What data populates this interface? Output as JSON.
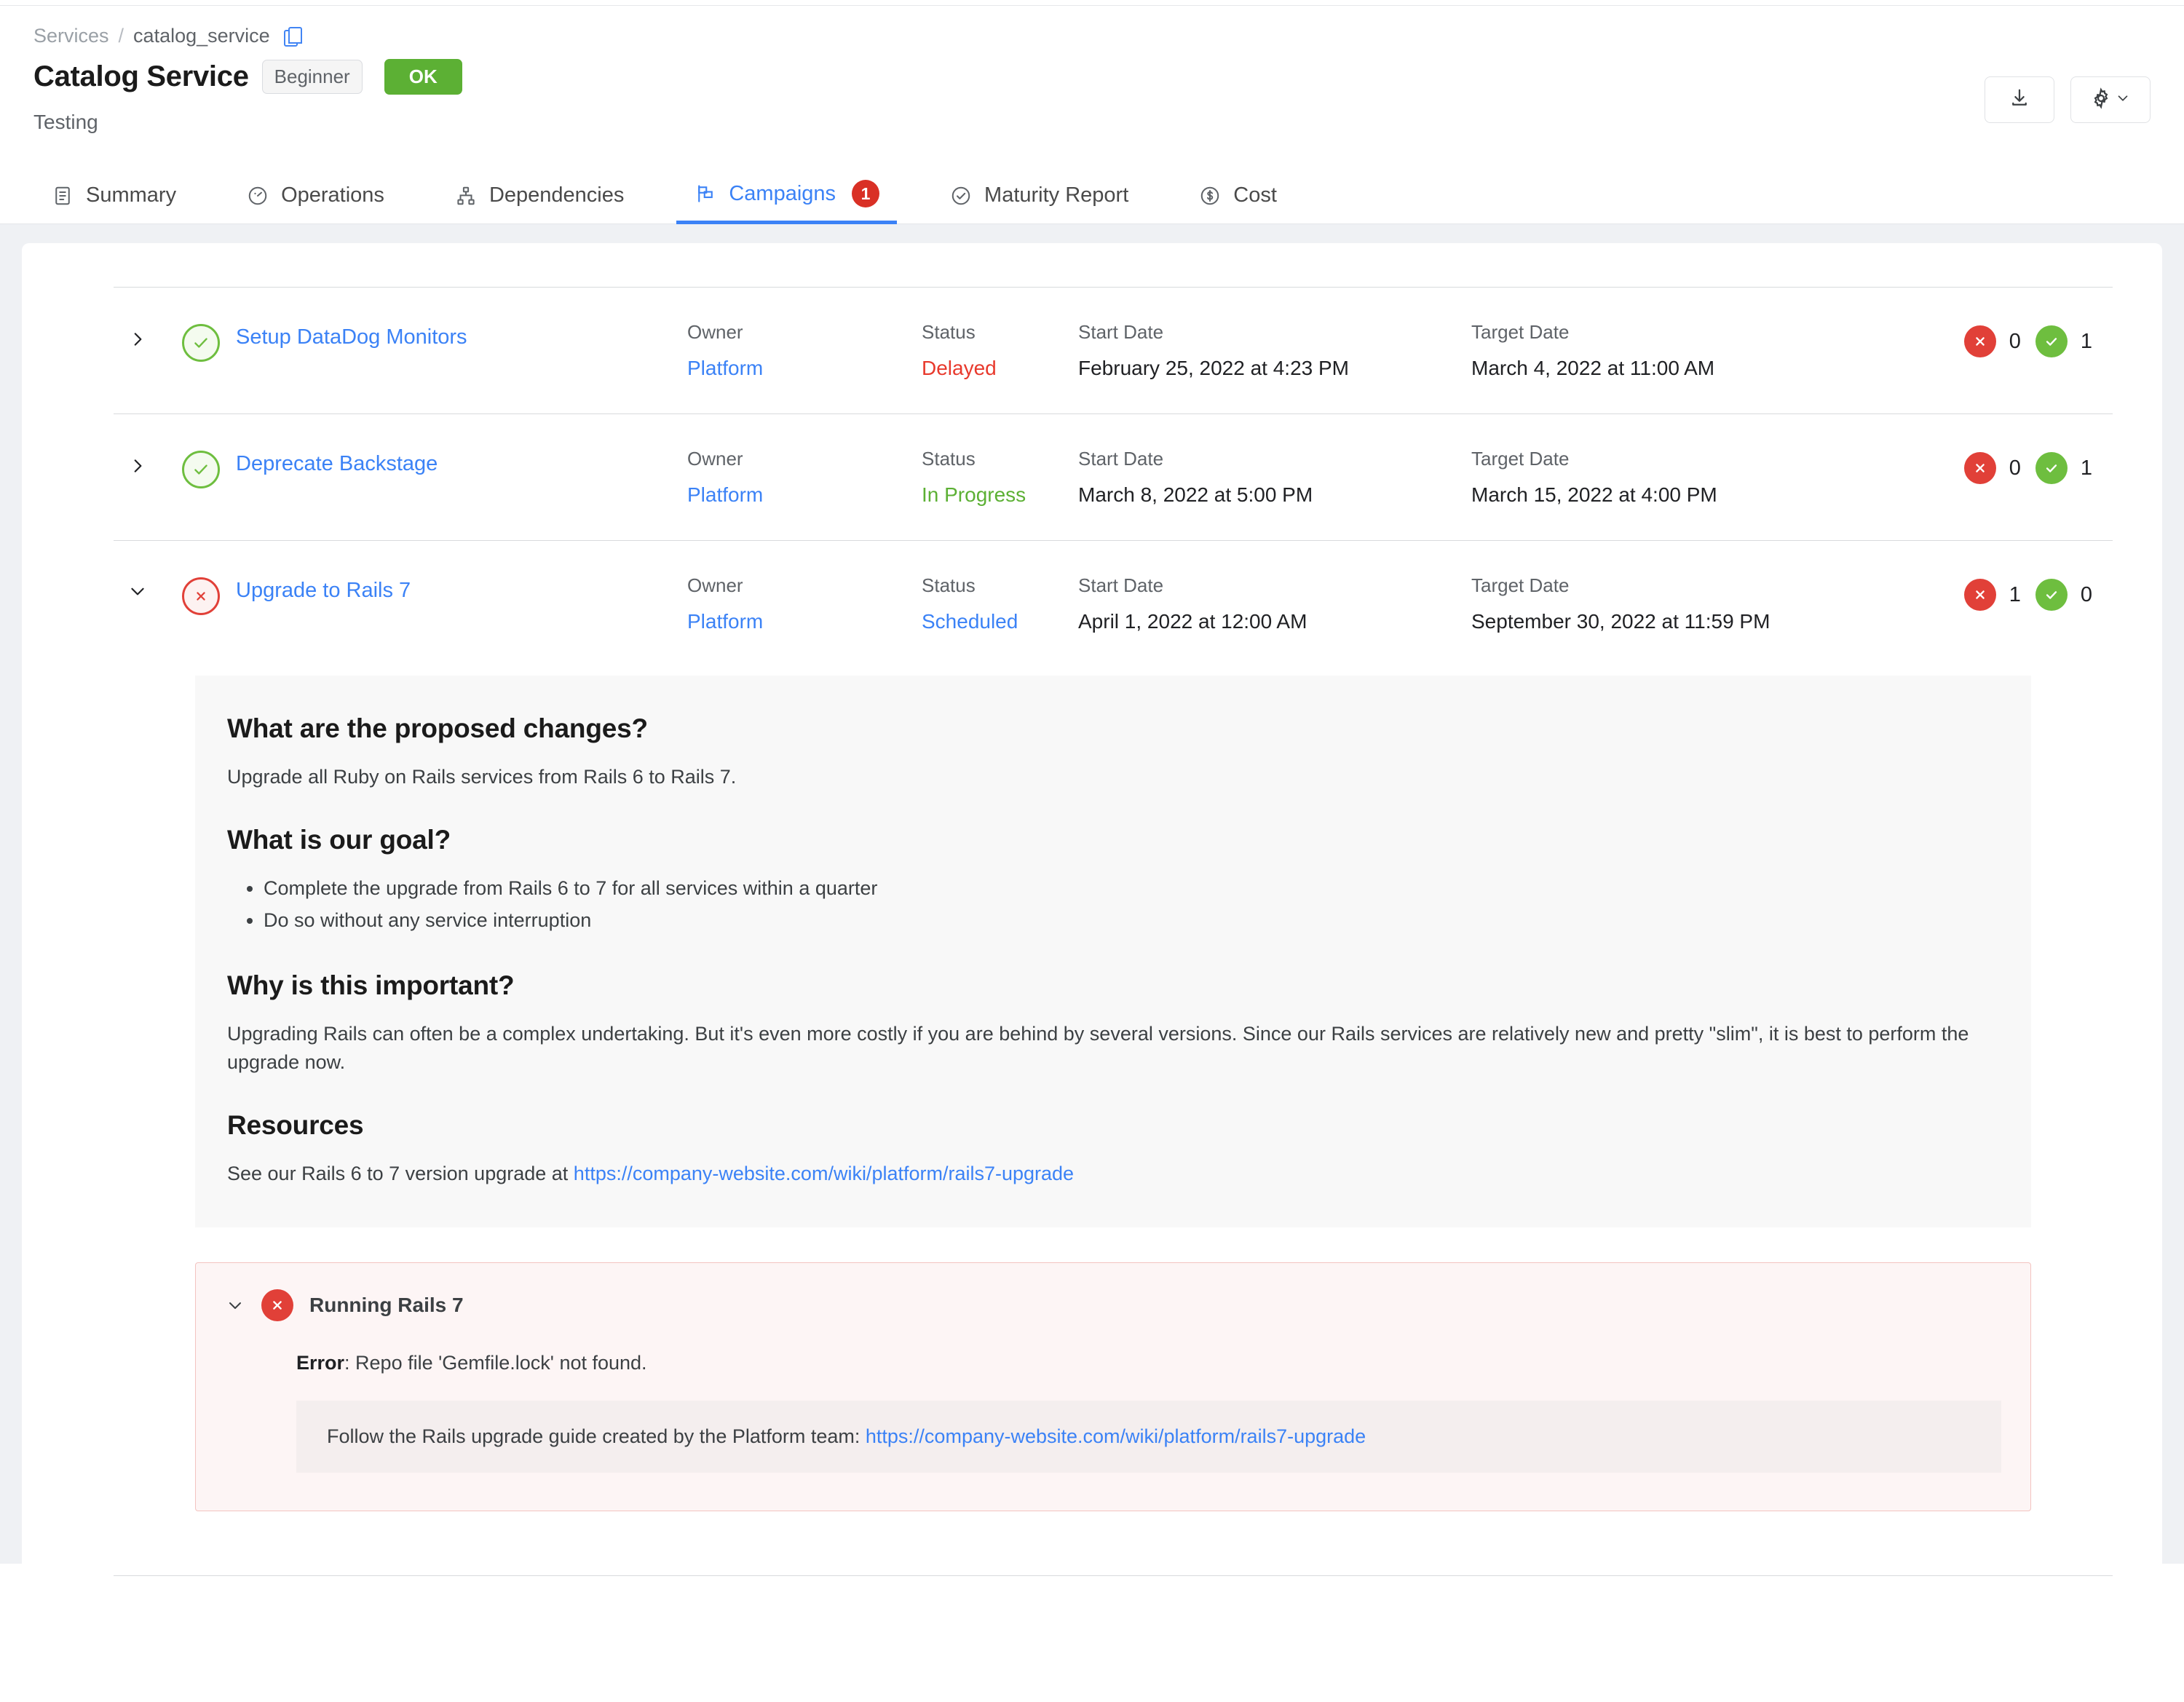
{
  "breadcrumb": {
    "root": "Services",
    "separator": "/",
    "current": "catalog_service",
    "copy_icon": "copy-icon"
  },
  "header": {
    "title": "Catalog Service",
    "level_chip": "Beginner",
    "status_chip": "OK",
    "subtitle": "Testing",
    "actions": [
      {
        "name": "download-button",
        "icon": "download-icon"
      },
      {
        "name": "settings-button",
        "icon": "gear-icon",
        "caret": "chevron-down-icon"
      }
    ]
  },
  "tabs": [
    {
      "label": "Summary",
      "icon": "list-document-icon",
      "active": false,
      "badge": null
    },
    {
      "label": "Operations",
      "icon": "gauge-icon",
      "active": false,
      "badge": null
    },
    {
      "label": "Dependencies",
      "icon": "hierarchy-icon",
      "active": false,
      "badge": null
    },
    {
      "label": "Campaigns",
      "icon": "flag-board-icon",
      "active": true,
      "badge": "1"
    },
    {
      "label": "Maturity Report",
      "icon": "check-circle-icon",
      "active": false,
      "badge": null
    },
    {
      "label": "Cost",
      "icon": "dollar-circle-icon",
      "active": false,
      "badge": null
    }
  ],
  "columns": {
    "owner": "Owner",
    "status": "Status",
    "start_date": "Start Date",
    "target_date": "Target Date"
  },
  "campaigns": [
    {
      "name": "Setup DataDog Monitors",
      "state_icon": "check-circle-outline-icon",
      "state": "ok",
      "expanded": false,
      "owner": "Platform",
      "status": "Delayed",
      "status_kind": "red",
      "start_date": "February 25, 2022 at 4:23 PM",
      "target_date": "March 4, 2022 at 11:00 AM",
      "fail_count": "0",
      "pass_count": "1"
    },
    {
      "name": "Deprecate Backstage",
      "state_icon": "check-circle-outline-icon",
      "state": "ok",
      "expanded": false,
      "owner": "Platform",
      "status": "In Progress",
      "status_kind": "green",
      "start_date": "March 8, 2022 at 5:00 PM",
      "target_date": "March 15, 2022 at 4:00 PM",
      "fail_count": "0",
      "pass_count": "1"
    },
    {
      "name": "Upgrade to Rails 7",
      "state_icon": "x-circle-outline-icon",
      "state": "error",
      "expanded": true,
      "owner": "Platform",
      "status": "Scheduled",
      "status_kind": "link",
      "start_date": "April 1, 2022 at 12:00 AM",
      "target_date": "September 30, 2022 at 11:59 PM",
      "fail_count": "1",
      "pass_count": "0"
    }
  ],
  "detail": {
    "h1": "What are the proposed changes?",
    "p1": "Upgrade all Ruby on Rails services from Rails 6 to Rails 7.",
    "h2": "What is our goal?",
    "goals": [
      "Complete the upgrade from Rails 6 to 7 for all services within a quarter",
      "Do so without any service interruption"
    ],
    "h3": "Why is this important?",
    "p3": "Upgrading Rails can often be a complex undertaking. But it's even more costly if you are behind by several versions. Since our Rails services are relatively new and pretty \"slim\", it is best to perform the upgrade now.",
    "h4": "Resources",
    "p4_prefix": "See our Rails 6 to 7 version upgrade at ",
    "p4_link": "https://company-website.com/wiki/platform/rails7-upgrade"
  },
  "error_panel": {
    "title": "Running Rails 7",
    "icon": "x-circle-filled-icon",
    "chevron": "chevron-down-icon",
    "error_label": "Error",
    "error_text": ": Repo file 'Gemfile.lock' not found.",
    "code_prefix": "Follow the Rails upgrade guide created by the Platform team: ",
    "code_link": "https://company-website.com/wiki/platform/rails7-upgrade"
  },
  "colors": {
    "accent_blue": "#3b82f6",
    "ok_green": "#5cb034",
    "error_red": "#e14038",
    "delayed_red": "#e8392c",
    "badge_red": "#d93025",
    "page_bg": "#eff1f4",
    "panel_bg": "#f8f8f8",
    "error_bg": "#fdf5f5",
    "error_border": "#f3c3c0"
  }
}
